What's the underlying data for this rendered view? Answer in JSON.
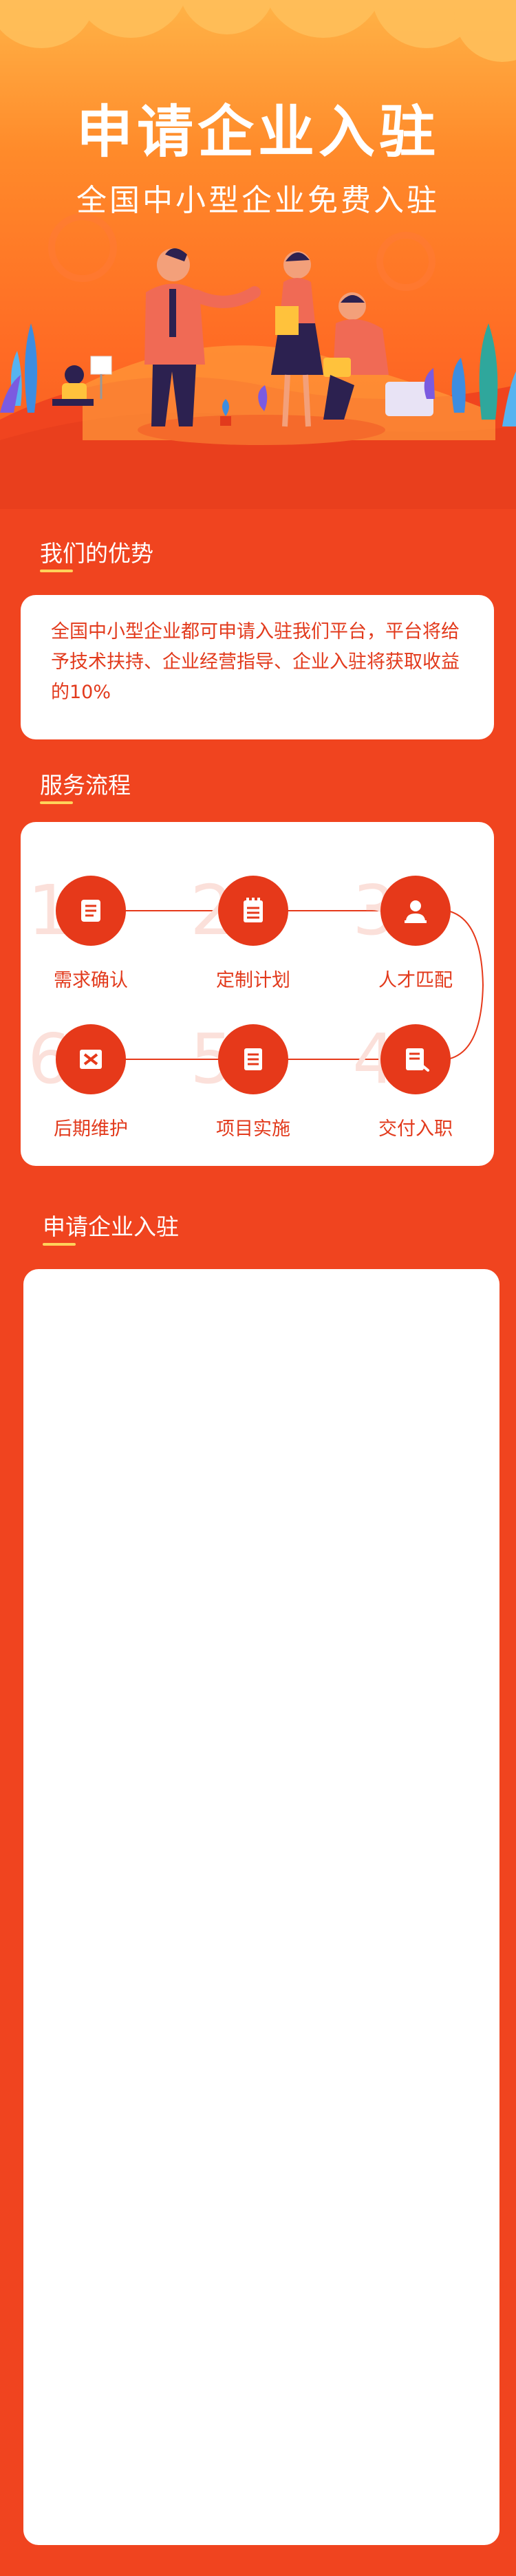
{
  "hero": {
    "title": "申请企业入驻",
    "subtitle": "全国中小型企业免费入驻"
  },
  "advantages": {
    "title": "我们的优势",
    "text": "全国中小型企业都可申请入驻我们平台，平台将给予技术扶持、企业经营指导、企业入驻将获取收益的10%"
  },
  "process": {
    "title": "服务流程",
    "steps": [
      {
        "num": "1",
        "label": "需求确认",
        "icon": "document-scroll-icon"
      },
      {
        "num": "2",
        "label": "定制计划",
        "icon": "notepad-icon"
      },
      {
        "num": "3",
        "label": "人才匹配",
        "icon": "person-icon"
      },
      {
        "num": "6",
        "label": "后期维护",
        "icon": "wrench-screwdriver-icon"
      },
      {
        "num": "5",
        "label": "项目实施",
        "icon": "document-list-icon"
      },
      {
        "num": "4",
        "label": "交付入职",
        "icon": "signed-document-icon"
      }
    ]
  },
  "apply": {
    "title": "申请企业入驻"
  },
  "colors": {
    "primary": "#f0441f",
    "accent": "#ffd35a",
    "icon_bg": "#e6391a",
    "text_red": "#e23a1c"
  }
}
